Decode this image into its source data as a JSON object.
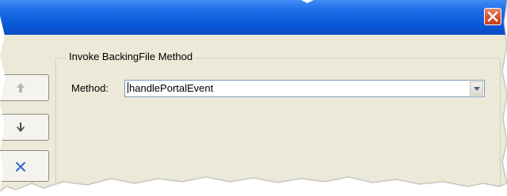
{
  "window": {
    "title": "",
    "close_icon": "close-icon",
    "titlebar_color": "#0b59d8",
    "close_color": "#d9542b"
  },
  "side_buttons": [
    {
      "icon": "arrow-up-icon",
      "state": "disabled"
    },
    {
      "icon": "arrow-down-icon",
      "state": "enabled"
    },
    {
      "icon": "delete-x-icon",
      "state": "enabled",
      "color": "#3366cc"
    }
  ],
  "groupbox": {
    "label": "Invoke BackingFile Method"
  },
  "method": {
    "label": "Method:",
    "value": "handlePortalEvent",
    "dropdown_icon": "chevron-down-icon"
  }
}
